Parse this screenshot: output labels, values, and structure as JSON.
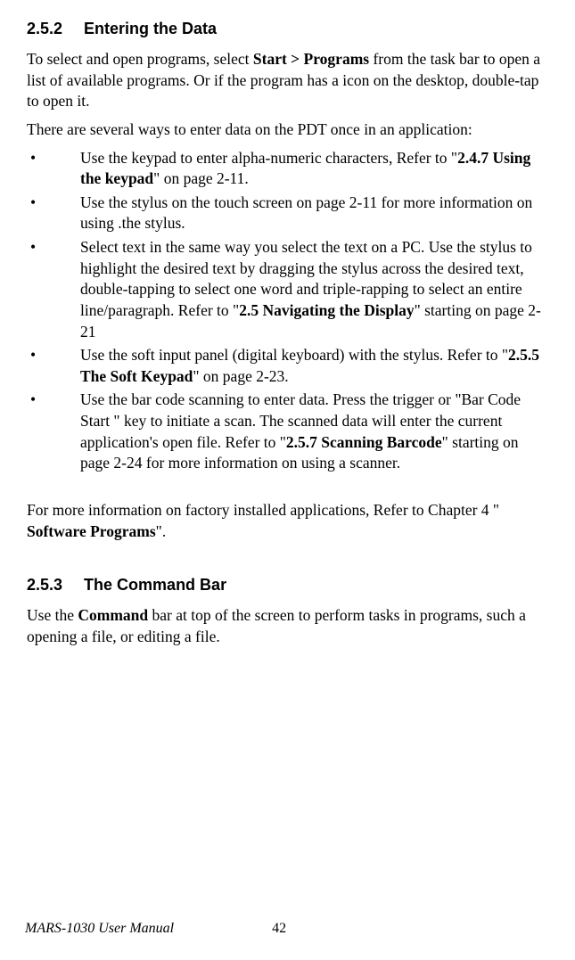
{
  "section252": {
    "number": "2.5.2",
    "title": "Entering the Data",
    "para1_a": "To select and open programs, select ",
    "para1_bold": "Start > Programs",
    "para1_b": " from the task bar to open a list of available programs. Or if the program has a icon on the desktop, double-tap to open it.",
    "para2": "There are several ways to enter data on the PDT once in an application:",
    "bullets": {
      "b1_a": "Use the keypad to enter alpha-numeric characters, Refer to \"",
      "b1_bold": "2.4.7 Using the keypad",
      "b1_b": "\" on page 2-11.",
      "b2": "Use the stylus on the touch screen on page 2-11 for more information on using .the stylus.",
      "b3_a": "Select text in the same way you select the text on a PC. Use the stylus to highlight the desired text by dragging the stylus across the desired text, double-tapping to select one word and triple-rapping to select an entire line/paragraph. Refer to \"",
      "b3_bold": "2.5 Navigating the Display",
      "b3_b": "\" starting on page 2-21",
      "b4_a": "Use the soft input panel (digital keyboard) with the stylus. Refer to \"",
      "b4_bold": "2.5.5 The Soft Keypad",
      "b4_b": "\" on page 2-23.",
      "b5_a": "Use the bar code scanning to enter data. Press the trigger or \"Bar Code Start \" key to initiate a scan. The scanned data will enter the current application's open file. Refer to \"",
      "b5_bold": "2.5.7 Scanning Barcode",
      "b5_b": "\" starting on page 2-24 for more information on using a scanner."
    },
    "para3_a": "For more information on factory installed applications, Refer to Chapter 4 \" ",
    "para3_bold": "Software Programs",
    "para3_b": "\"."
  },
  "section253": {
    "number": "2.5.3",
    "title": "The Command Bar",
    "para1_a": " Use the ",
    "para1_bold": "Command",
    "para1_b": " bar at top of the screen to perform tasks in programs, such a opening a file, or editing a file."
  },
  "footer": {
    "manual": "MARS-1030 User Manual",
    "page": "42"
  },
  "bullet_char": "•"
}
